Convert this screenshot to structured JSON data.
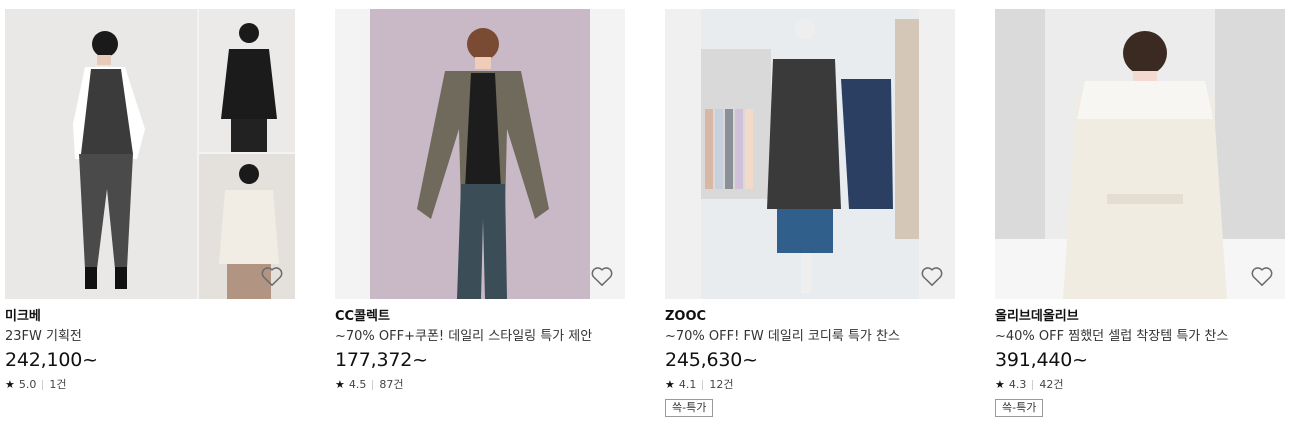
{
  "products": [
    {
      "brand": "미크베",
      "title": "23FW 기획전",
      "price": "242,100~",
      "rating": "5.0",
      "reviews": "1건",
      "badge": null,
      "icon": "heart-outline-icon"
    },
    {
      "brand": "CC콜렉트",
      "title": "~70% OFF+쿠폰! 데일리 스타일링 특가 제안",
      "price": "177,372~",
      "rating": "4.5",
      "reviews": "87건",
      "badge": null,
      "icon": "heart-outline-icon"
    },
    {
      "brand": "ZOOC",
      "title": "~70% OFF! FW 데일리 코디룩 특가 찬스",
      "price": "245,630~",
      "rating": "4.1",
      "reviews": "12건",
      "badge": "쓱-특가",
      "icon": "heart-outline-icon"
    },
    {
      "brand": "올리브데올리브",
      "title": "~40% OFF 찜했던 셀럽 착장템 특가 찬스",
      "price": "391,440~",
      "rating": "4.3",
      "reviews": "42건",
      "badge": "쓱-특가",
      "icon": "heart-outline-icon"
    }
  ],
  "rating_star": "★"
}
